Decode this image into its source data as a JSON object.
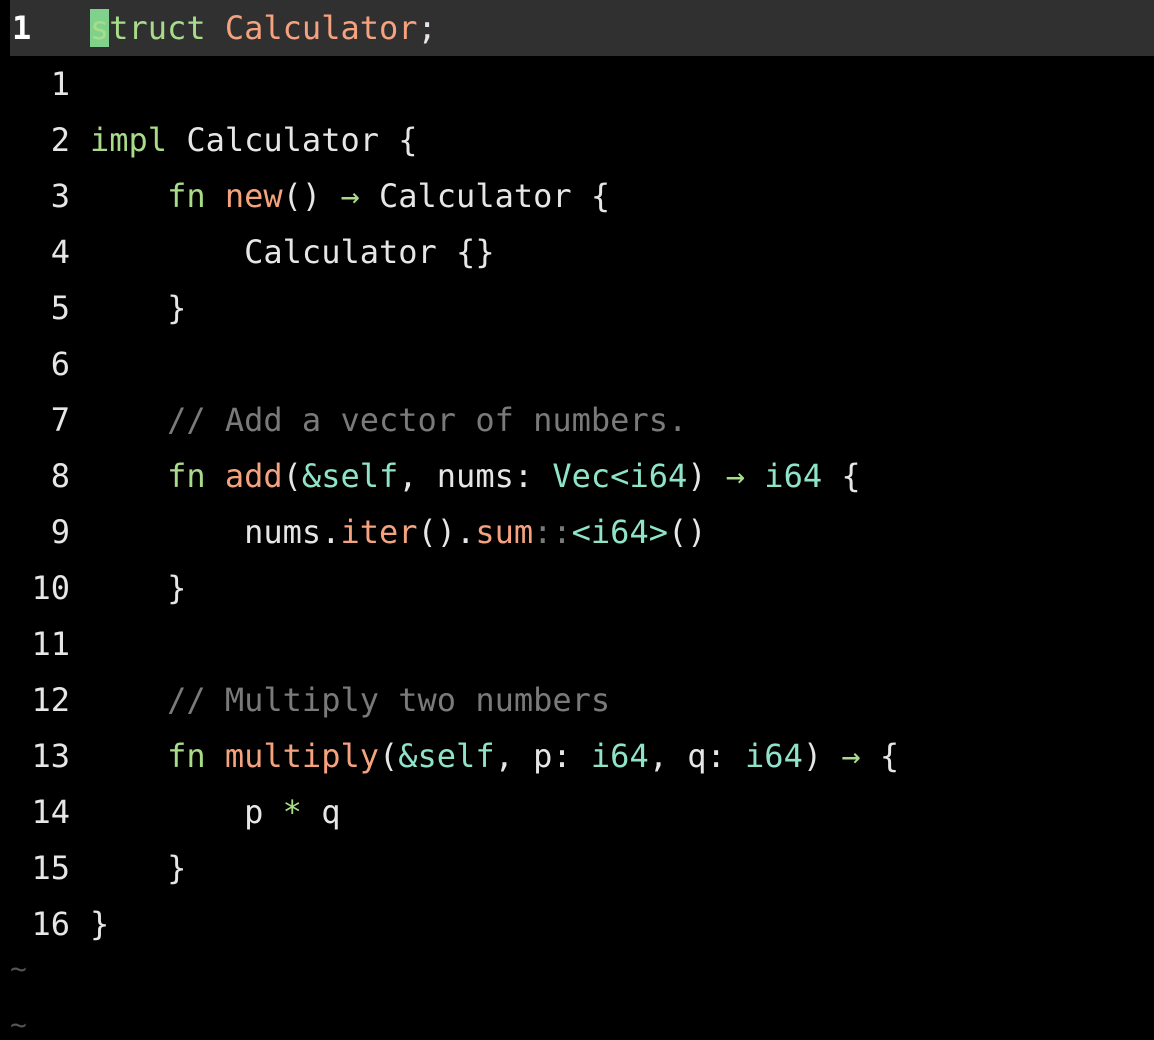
{
  "editor": {
    "current_line": {
      "number": "1",
      "tokens": [
        {
          "text": "s",
          "cls": "cursor kw"
        },
        {
          "text": "truct",
          "cls": "kw"
        },
        {
          "text": " ",
          "cls": "plain"
        },
        {
          "text": "Calculator",
          "cls": "struct-name"
        },
        {
          "text": ";",
          "cls": "punct"
        }
      ]
    },
    "lines": [
      {
        "number": "1",
        "tokens": []
      },
      {
        "number": "2",
        "tokens": [
          {
            "text": "impl",
            "cls": "kw"
          },
          {
            "text": " Calculator {",
            "cls": "plain"
          }
        ]
      },
      {
        "number": "3",
        "tokens": [
          {
            "text": "    ",
            "cls": "plain"
          },
          {
            "text": "fn",
            "cls": "kw"
          },
          {
            "text": " ",
            "cls": "plain"
          },
          {
            "text": "new",
            "cls": "fnname"
          },
          {
            "text": "() ",
            "cls": "plain"
          },
          {
            "text": "→",
            "cls": "arrow"
          },
          {
            "text": " Calculator {",
            "cls": "plain"
          }
        ]
      },
      {
        "number": "4",
        "tokens": [
          {
            "text": "        Calculator {}",
            "cls": "plain"
          }
        ]
      },
      {
        "number": "5",
        "tokens": [
          {
            "text": "    }",
            "cls": "plain"
          }
        ]
      },
      {
        "number": "6",
        "tokens": []
      },
      {
        "number": "7",
        "tokens": [
          {
            "text": "    // Add a vector of numbers.",
            "cls": "comment"
          }
        ]
      },
      {
        "number": "8",
        "tokens": [
          {
            "text": "    ",
            "cls": "plain"
          },
          {
            "text": "fn",
            "cls": "kw"
          },
          {
            "text": " ",
            "cls": "plain"
          },
          {
            "text": "add",
            "cls": "fnname"
          },
          {
            "text": "(",
            "cls": "plain"
          },
          {
            "text": "&self",
            "cls": "self"
          },
          {
            "text": ", nums: ",
            "cls": "plain"
          },
          {
            "text": "Vec<i64",
            "cls": "type"
          },
          {
            "text": ") ",
            "cls": "plain"
          },
          {
            "text": "→",
            "cls": "arrow"
          },
          {
            "text": " ",
            "cls": "plain"
          },
          {
            "text": "i64",
            "cls": "type"
          },
          {
            "text": " {",
            "cls": "plain"
          }
        ]
      },
      {
        "number": "9",
        "tokens": [
          {
            "text": "        nums.",
            "cls": "plain"
          },
          {
            "text": "iter",
            "cls": "fnname"
          },
          {
            "text": "().",
            "cls": "plain"
          },
          {
            "text": "sum",
            "cls": "fnname"
          },
          {
            "text": "::",
            "cls": "comment"
          },
          {
            "text": "<i64>",
            "cls": "type"
          },
          {
            "text": "()",
            "cls": "plain"
          }
        ]
      },
      {
        "number": "10",
        "tokens": [
          {
            "text": "    }",
            "cls": "plain"
          }
        ]
      },
      {
        "number": "11",
        "tokens": []
      },
      {
        "number": "12",
        "tokens": [
          {
            "text": "    // Multiply two numbers",
            "cls": "comment"
          }
        ]
      },
      {
        "number": "13",
        "tokens": [
          {
            "text": "    ",
            "cls": "plain"
          },
          {
            "text": "fn",
            "cls": "kw"
          },
          {
            "text": " ",
            "cls": "plain"
          },
          {
            "text": "multiply",
            "cls": "fnname"
          },
          {
            "text": "(",
            "cls": "plain"
          },
          {
            "text": "&self",
            "cls": "self"
          },
          {
            "text": ", p: ",
            "cls": "plain"
          },
          {
            "text": "i64",
            "cls": "type"
          },
          {
            "text": ", q: ",
            "cls": "plain"
          },
          {
            "text": "i64",
            "cls": "type"
          },
          {
            "text": ") ",
            "cls": "plain"
          },
          {
            "text": "→",
            "cls": "arrow"
          },
          {
            "text": " {",
            "cls": "plain"
          }
        ]
      },
      {
        "number": "14",
        "tokens": [
          {
            "text": "        p ",
            "cls": "plain"
          },
          {
            "text": "*",
            "cls": "op"
          },
          {
            "text": " q",
            "cls": "plain"
          }
        ]
      },
      {
        "number": "15",
        "tokens": [
          {
            "text": "    }",
            "cls": "plain"
          }
        ]
      },
      {
        "number": "16",
        "tokens": [
          {
            "text": "}",
            "cls": "plain"
          }
        ]
      }
    ],
    "empty_markers": [
      "~",
      "~"
    ]
  }
}
